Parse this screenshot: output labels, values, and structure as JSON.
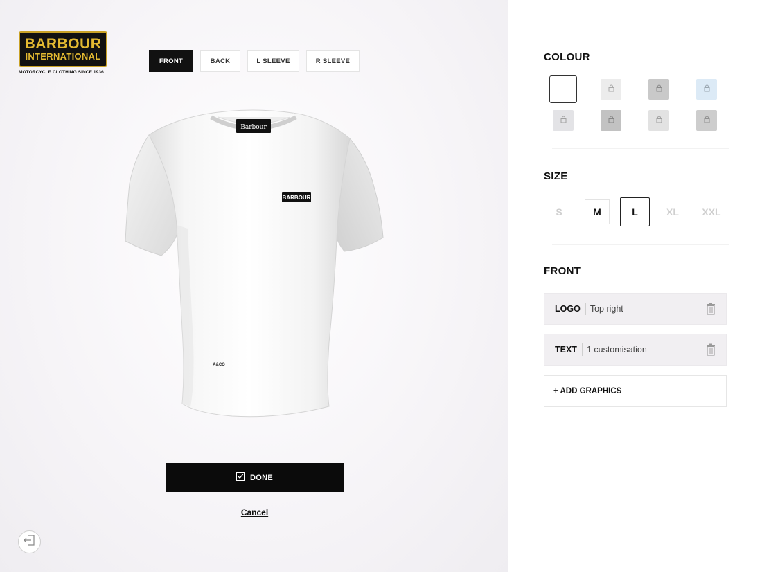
{
  "brand": {
    "line1": "BARBOUR",
    "line2": "INTERNATIONAL",
    "tagline": "MOTORCYCLE CLOTHING SINCE 1936."
  },
  "view_tabs": [
    {
      "label": "FRONT",
      "active": true
    },
    {
      "label": "BACK",
      "active": false
    },
    {
      "label": "L SLEEVE",
      "active": false
    },
    {
      "label": "R SLEEVE",
      "active": false
    }
  ],
  "preview": {
    "neck_label": "Barbour",
    "chest_logo": "BARBOUR",
    "hem_text": "A&CO"
  },
  "actions": {
    "done_label": "DONE",
    "cancel_label": "Cancel"
  },
  "colour": {
    "title": "COLOUR",
    "swatches": [
      {
        "color": "#ffffff",
        "locked": false,
        "selected": true
      },
      {
        "color": "#ececec",
        "locked": true,
        "selected": false
      },
      {
        "color": "#c9c9c9",
        "locked": true,
        "selected": false
      },
      {
        "color": "#dceaf6",
        "locked": true,
        "selected": false
      },
      {
        "color": "#e3e3e6",
        "locked": true,
        "selected": false
      },
      {
        "color": "#c2c2c2",
        "locked": true,
        "selected": false
      },
      {
        "color": "#e2e2e2",
        "locked": true,
        "selected": false
      },
      {
        "color": "#cdcdcd",
        "locked": true,
        "selected": false
      }
    ]
  },
  "size": {
    "title": "SIZE",
    "options": [
      {
        "label": "S",
        "available": false,
        "selected": false
      },
      {
        "label": "M",
        "available": true,
        "selected": false
      },
      {
        "label": "L",
        "available": true,
        "selected": true
      },
      {
        "label": "XL",
        "available": false,
        "selected": false
      },
      {
        "label": "XXL",
        "available": false,
        "selected": false
      }
    ]
  },
  "front": {
    "title": "FRONT",
    "items": [
      {
        "label": "LOGO",
        "value": "Top right"
      },
      {
        "label": "TEXT",
        "value": "1 customisation"
      }
    ],
    "add_label": "+ ADD GRAPHICS"
  }
}
